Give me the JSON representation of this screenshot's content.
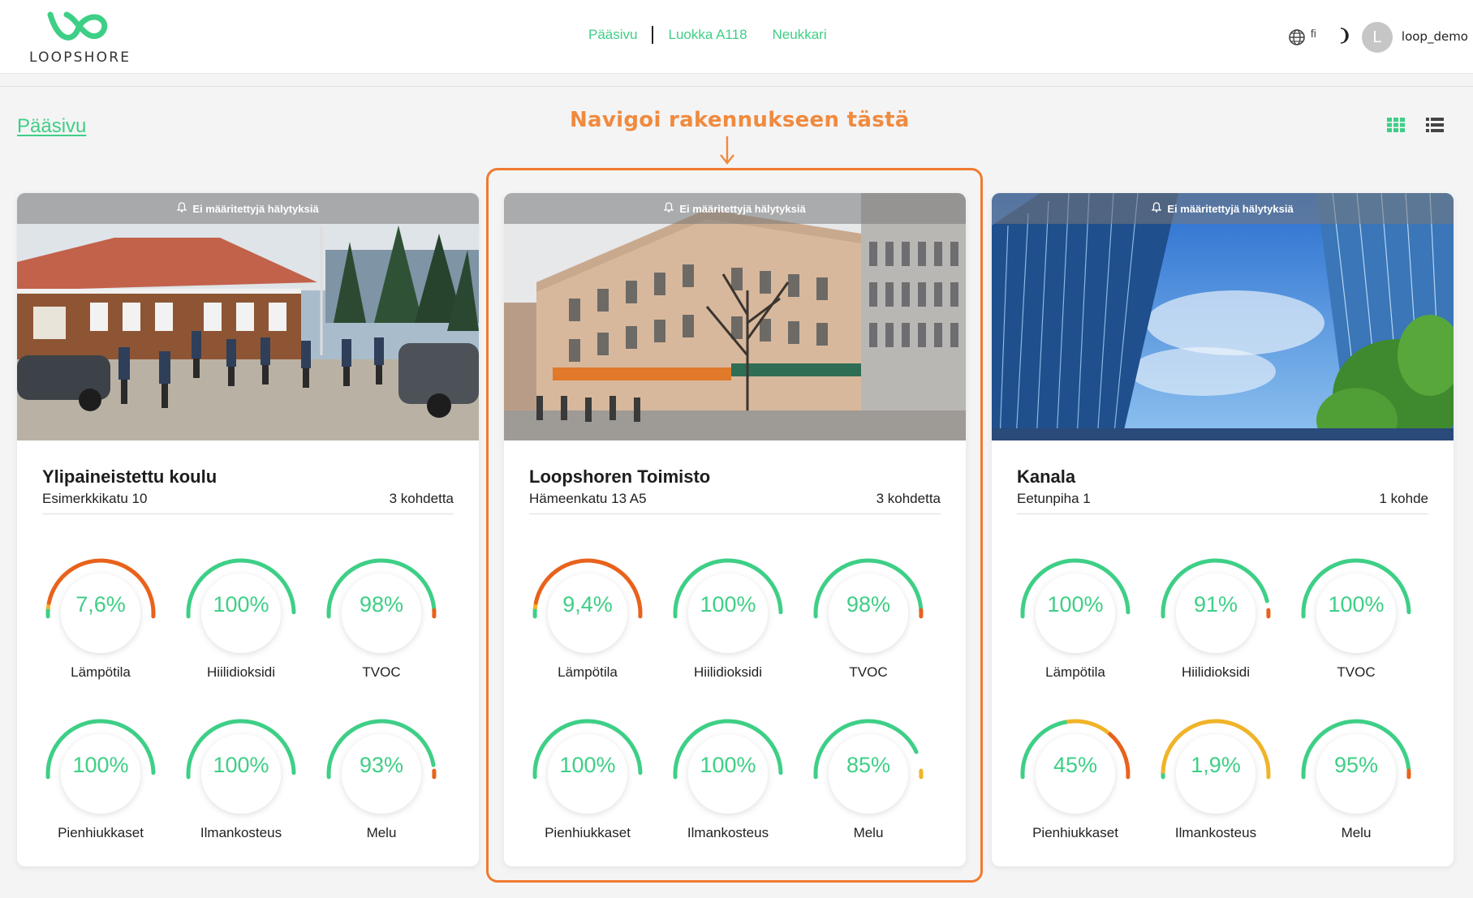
{
  "header": {
    "logo_text": "LOOPSHORE",
    "nav": [
      "Pääsivu",
      "Luokka A118",
      "Neukkari"
    ],
    "language": "fi",
    "avatar_initial": "L",
    "username": "loop_demo"
  },
  "page": {
    "title": "Pääsivu"
  },
  "annotation": {
    "text": "Navigoi rakennukseen tästä",
    "arrow": "↓"
  },
  "colors": {
    "accent": "#3ecf86",
    "warning": "#f0b429",
    "danger": "#e8621c",
    "annotation": "#f08a3e"
  },
  "cards": [
    {
      "alarm": "Ei määritettyjä hälytyksiä",
      "title": "Ylipaineistettu koulu",
      "address": "Esimerkkikatu 10",
      "count": "3 kohdetta",
      "image": "school-photo",
      "metrics": [
        {
          "label": "Lämpötila",
          "value": "7,6%",
          "pct": 7.6,
          "color": "orange"
        },
        {
          "label": "Hiilidioksidi",
          "value": "100%",
          "pct": 100,
          "color": "green"
        },
        {
          "label": "TVOC",
          "value": "98%",
          "pct": 98,
          "color": "green"
        },
        {
          "label": "Pienhiukkaset",
          "value": "100%",
          "pct": 100,
          "color": "green"
        },
        {
          "label": "Ilmankosteus",
          "value": "100%",
          "pct": 100,
          "color": "green"
        },
        {
          "label": "Melu",
          "value": "93%",
          "pct": 93,
          "color": "green"
        }
      ]
    },
    {
      "alarm": "Ei määritettyjä hälytyksiä",
      "title": "Loopshoren Toimisto",
      "address": "Hämeenkatu 13 A5",
      "count": "3 kohdetta",
      "image": "office-building-photo",
      "metrics": [
        {
          "label": "Lämpötila",
          "value": "9,4%",
          "pct": 9.4,
          "color": "orange"
        },
        {
          "label": "Hiilidioksidi",
          "value": "100%",
          "pct": 100,
          "color": "green"
        },
        {
          "label": "TVOC",
          "value": "98%",
          "pct": 98,
          "color": "green"
        },
        {
          "label": "Pienhiukkaset",
          "value": "100%",
          "pct": 100,
          "color": "green"
        },
        {
          "label": "Ilmankosteus",
          "value": "100%",
          "pct": 100,
          "color": "green"
        },
        {
          "label": "Melu",
          "value": "85%",
          "pct": 85,
          "color": "green"
        }
      ]
    },
    {
      "alarm": "Ei määritettyjä hälytyksiä",
      "title": "Kanala",
      "address": "Eetunpiha 1",
      "count": "1 kohde",
      "image": "skyscrapers-photo",
      "metrics": [
        {
          "label": "Lämpötila",
          "value": "100%",
          "pct": 100,
          "color": "green"
        },
        {
          "label": "Hiilidioksidi",
          "value": "91%",
          "pct": 91,
          "color": "green"
        },
        {
          "label": "TVOC",
          "value": "100%",
          "pct": 100,
          "color": "green"
        },
        {
          "label": "Pienhiukkaset",
          "value": "45%",
          "pct": 45,
          "color": "mixed"
        },
        {
          "label": "Ilmankosteus",
          "value": "1,9%",
          "pct": 1.9,
          "color": "yellow"
        },
        {
          "label": "Melu",
          "value": "95%",
          "pct": 95,
          "color": "green"
        }
      ]
    }
  ]
}
